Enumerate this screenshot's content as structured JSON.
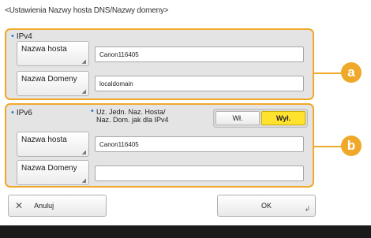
{
  "window": {
    "title": "<Ustawienia Nazwy hosta DNS/Nazwy domeny>"
  },
  "ipv4": {
    "section_label": "IPv4",
    "host_button": "Nazwa hosta",
    "host_value": "Canon116405",
    "domain_button": "Nazwa Domeny",
    "domain_value": "localdomain"
  },
  "ipv6": {
    "section_label": "IPv6",
    "same_as_ipv4_label_line1": "Uż. Jedn. Naz. Hosta/",
    "same_as_ipv4_label_line2": "Naz. Dom. jak dla IPv4",
    "toggle_on": "Wł.",
    "toggle_off": "Wył.",
    "toggle_selected": "Wył.",
    "host_button": "Nazwa hosta",
    "host_value": "Canon116405",
    "domain_button": "Nazwa Domeny",
    "domain_value": ""
  },
  "callouts": {
    "a": "a",
    "b": "b"
  },
  "footer": {
    "cancel_label": "Anuluj",
    "ok_label": "OK"
  },
  "colors": {
    "accent": "#f0a82a",
    "selected": "#ffe22e",
    "bullet": "#2a7ad0"
  },
  "icons": {
    "cancel": "close-icon",
    "ok": "return-icon",
    "button_corner": "corner-arrow-icon"
  }
}
